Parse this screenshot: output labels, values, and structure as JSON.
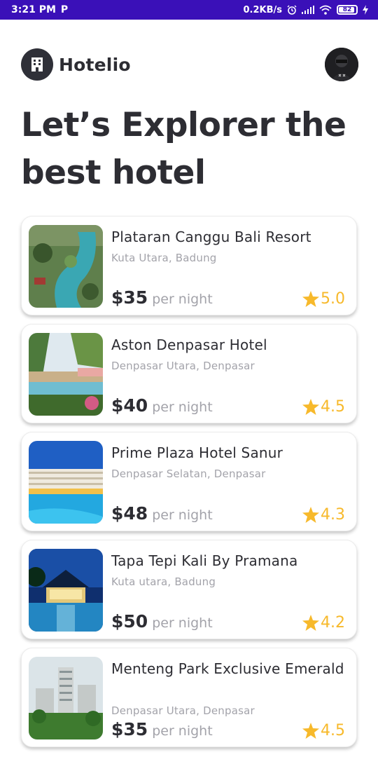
{
  "status_bar": {
    "time": "3:21 PM",
    "app_indicator": "P",
    "network_speed": "0.2KB/s",
    "battery_level": "82"
  },
  "header": {
    "brand_name": "Hotelio",
    "logo_icon": "building-icon",
    "avatar_icon": "user-avatar"
  },
  "headline": "Let’s Explorer the best hotel",
  "hotels": [
    {
      "name": "Plataran Canggu Bali Resort",
      "location": "Kuta Utara, Badung",
      "price": "$35",
      "per_night": "per night",
      "rating": "5.0"
    },
    {
      "name": "Aston Denpasar Hotel",
      "location": "Denpasar Utara, Denpasar",
      "price": "$40",
      "per_night": "per night",
      "rating": "4.5"
    },
    {
      "name": "Prime Plaza Hotel Sanur",
      "location": "Denpasar Selatan, Denpasar",
      "price": "$48",
      "per_night": "per night",
      "rating": "4.3"
    },
    {
      "name": "Tapa Tepi Kali By Pramana",
      "location": "Kuta utara, Badung",
      "price": "$50",
      "per_night": "per night",
      "rating": "4.2"
    },
    {
      "name": "Menteng Park Exclusive Emerald",
      "location": "Denpasar Utara, Denpasar",
      "price": "$35",
      "per_night": "per night",
      "rating": "4.5"
    }
  ],
  "colors": {
    "status_bar": "#3a10b8",
    "text_primary": "#2d2d33",
    "text_muted": "#a3a3aa",
    "star": "#f7b92b"
  }
}
